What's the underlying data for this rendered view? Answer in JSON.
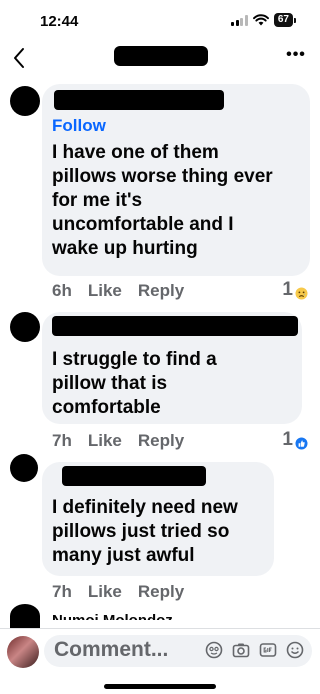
{
  "status": {
    "time": "12:44",
    "battery": "67"
  },
  "nav": {
    "more": "•••"
  },
  "comments": [
    {
      "follow": "Follow",
      "text_lines": [
        "I have one of them",
        "pillows worse thing ever",
        "for me it's",
        "uncomfortable and I",
        "wake up hurting"
      ],
      "time": "6h",
      "like": "Like",
      "reply": "Reply",
      "reaction_count": "1",
      "reaction": "sad-emoji"
    },
    {
      "text_lines": [
        "I struggle to find a",
        "pillow that is",
        "comfortable"
      ],
      "time": "7h",
      "like": "Like",
      "reply": "Reply",
      "reaction_count": "1",
      "reaction": "like-emoji"
    },
    {
      "text_lines": [
        "I definitely need new",
        "pillows just tried so",
        "many just awful"
      ],
      "time": "7h",
      "like": "Like",
      "reply": "Reply"
    }
  ],
  "partial_commenter": "Numoi Molondoz",
  "composer": {
    "placeholder": "Comment..."
  },
  "colors": {
    "link_blue": "#0866ff",
    "bubble_gray": "#f0f2f5",
    "meta_gray": "#65676b",
    "sad_yellow": "#f7c94a",
    "like_blue": "#1877f2"
  }
}
